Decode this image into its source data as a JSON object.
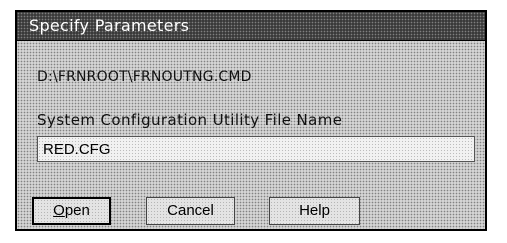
{
  "dialog": {
    "title": "Specify Parameters",
    "command_path": "D:\\FRNROOT\\FRNOUTNG.CMD",
    "field_label": "System Configuration Utility File Name",
    "file_name_value": "RED.CFG"
  },
  "buttons": {
    "open_mnemonic": "O",
    "open_rest": "pen",
    "cancel_label": "Cancel",
    "help_label": "Help"
  }
}
